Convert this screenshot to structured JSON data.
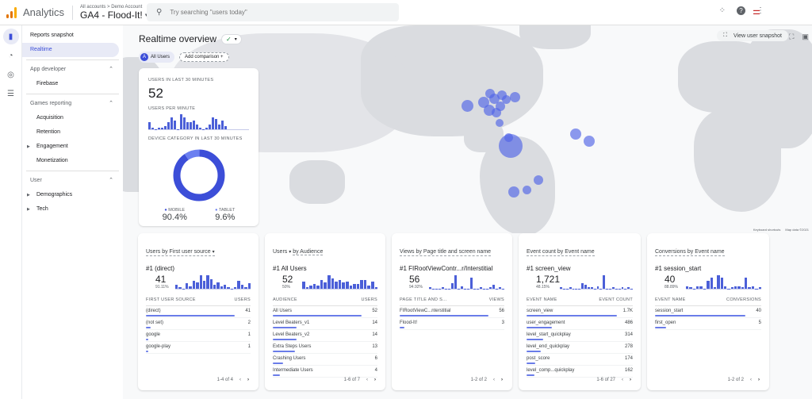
{
  "header": {
    "app_name": "Analytics",
    "breadcrumb": "All accounts > Demo Account",
    "property": "GA4 - Flood-It!",
    "search_placeholder": "Try searching \"users today\"",
    "logo_colors": [
      "#f9ab00",
      "#e37400",
      "#e37400"
    ]
  },
  "rail": [
    "reports-icon",
    "explore-icon",
    "advertising-icon",
    "configure-icon"
  ],
  "sidenav": {
    "items": [
      {
        "type": "item",
        "label": "Reports snapshot"
      },
      {
        "type": "item",
        "label": "Realtime",
        "active": true
      }
    ],
    "sections": [
      {
        "label": "App developer",
        "items": [
          {
            "label": "Firebase",
            "expandable": false
          }
        ]
      },
      {
        "label": "Games reporting",
        "items": [
          {
            "label": "Acquisition",
            "expandable": false
          },
          {
            "label": "Retention",
            "expandable": false
          },
          {
            "label": "Engagement",
            "expandable": true
          },
          {
            "label": "Monetization",
            "expandable": false
          }
        ]
      },
      {
        "label": "User",
        "items": [
          {
            "label": "Demographics",
            "expandable": true
          },
          {
            "label": "Tech",
            "expandable": true
          }
        ]
      }
    ]
  },
  "map": {
    "title": "Realtime overview",
    "chip_all_users": "All Users",
    "chip_letter": "A",
    "add_comparison": "Add comparison",
    "view_snapshot": "View user snapshot",
    "footer_shortcuts": "Keyboard shortcuts",
    "footer_mapdata": "Map data ©2021",
    "accent": "#4b5fd8"
  },
  "realtime_card": {
    "users_label": "USERS IN LAST 30 MINUTES",
    "users_value": "52",
    "per_minute_label": "USERS PER MINUTE",
    "per_minute": [
      5,
      1,
      0,
      1,
      1,
      2,
      5,
      8,
      6,
      0,
      10,
      8,
      5,
      5,
      6,
      3,
      1,
      0,
      1,
      3,
      8,
      7,
      3,
      6,
      2
    ],
    "device_label": "DEVICE CATEGORY IN LAST 30 MINUTES",
    "devices": [
      {
        "name": "MOBILE",
        "value": "90.4%",
        "pct": 90.4,
        "color": "#3c4ed8"
      },
      {
        "name": "TABLET",
        "value": "9.6%",
        "pct": 9.6,
        "color": "#6b7ff0"
      }
    ]
  },
  "cards": [
    {
      "title": "Users by First user source",
      "has_dropdown": true,
      "top_label": "#1  (direct)",
      "top_value": "41",
      "top_pct": "91.11%",
      "spark": [
        3,
        1,
        0,
        4,
        2,
        6,
        5,
        10,
        6,
        10,
        7,
        3,
        5,
        2,
        3,
        1,
        0,
        1,
        6,
        3,
        1,
        4
      ],
      "col1": "FIRST USER SOURCE",
      "col2": "USERS",
      "rows": [
        {
          "name": "(direct)",
          "value": "41",
          "frac": 1.0
        },
        {
          "name": "(not set)",
          "value": "2",
          "frac": 0.05
        },
        {
          "name": "google",
          "value": "1",
          "frac": 0.025
        },
        {
          "name": "google-play",
          "value": "1",
          "frac": 0.025
        }
      ],
      "pager": "1-4 of 4"
    },
    {
      "title": "Users",
      "title_suffix": "by Audience",
      "top_label": "#1  All Users",
      "top_value": "52",
      "top_pct": "50%",
      "spark": [
        5,
        1,
        2,
        3,
        2,
        6,
        4,
        9,
        7,
        5,
        6,
        4,
        5,
        2,
        3,
        3,
        6,
        6,
        2,
        5,
        1
      ],
      "col1": "AUDIENCE",
      "col2": "USERS",
      "rows": [
        {
          "name": "All Users",
          "value": "52",
          "frac": 1.0
        },
        {
          "name": "Level Beaters_v1",
          "value": "14",
          "frac": 0.27
        },
        {
          "name": "Level Beaters_v2",
          "value": "14",
          "frac": 0.27
        },
        {
          "name": "Extra Steps Users",
          "value": "13",
          "frac": 0.25
        },
        {
          "name": "Crashing Users",
          "value": "6",
          "frac": 0.12
        },
        {
          "name": "Intermediate Users",
          "value": "4",
          "frac": 0.08
        }
      ],
      "pager": "1-6 of 7"
    },
    {
      "title": "Views by Page title and screen name",
      "top_label": "#1  FIRootViewContr...r/Interstitial",
      "top_value": "56",
      "top_pct": "94.92%",
      "spark": [
        1,
        0,
        0,
        0,
        1,
        0,
        0,
        4,
        10,
        0,
        2,
        0,
        0,
        8,
        0,
        0,
        1,
        0,
        0,
        1,
        3,
        0,
        1,
        0
      ],
      "col1": "PAGE TITLE AND S...",
      "col2": "VIEWS",
      "rows": [
        {
          "name": "FIRootViewC...nterstitial",
          "value": "56",
          "frac": 1.0
        },
        {
          "name": "Flood-It!",
          "value": "3",
          "frac": 0.05
        }
      ],
      "pager": "1-2 of 2"
    },
    {
      "title": "Event count by Event name",
      "top_label": "#1  screen_view",
      "top_value": "1,721",
      "top_pct": "48.15%",
      "spark": [
        1,
        0,
        0,
        1,
        0,
        0,
        0,
        4,
        3,
        1,
        1,
        0,
        2,
        0,
        10,
        0,
        0,
        1,
        0,
        0,
        1,
        0,
        1,
        0
      ],
      "col1": "EVENT NAME",
      "col2": "EVENT COUNT",
      "rows": [
        {
          "name": "screen_view",
          "value": "1.7K",
          "frac": 1.0
        },
        {
          "name": "user_engagement",
          "value": "486",
          "frac": 0.28
        },
        {
          "name": "level_start_quickplay",
          "value": "314",
          "frac": 0.18
        },
        {
          "name": "level_end_quickplay",
          "value": "278",
          "frac": 0.16
        },
        {
          "name": "post_score",
          "value": "174",
          "frac": 0.1
        },
        {
          "name": "level_comp...quickplay",
          "value": "162",
          "frac": 0.09
        }
      ],
      "pager": "1-6 of 27"
    },
    {
      "title": "Conversions by Event name",
      "top_label": "#1  session_start",
      "top_value": "40",
      "top_pct": "88.89%",
      "spark": [
        2,
        1,
        0,
        2,
        2,
        0,
        6,
        8,
        1,
        10,
        8,
        2,
        0,
        1,
        2,
        2,
        1,
        8,
        1,
        2,
        0,
        1
      ],
      "col1": "EVENT NAME",
      "col2": "CONVERSIONS",
      "rows": [
        {
          "name": "session_start",
          "value": "40",
          "frac": 1.0
        },
        {
          "name": "first_open",
          "value": "5",
          "frac": 0.125
        }
      ],
      "pager": "1-2 of 2"
    }
  ]
}
